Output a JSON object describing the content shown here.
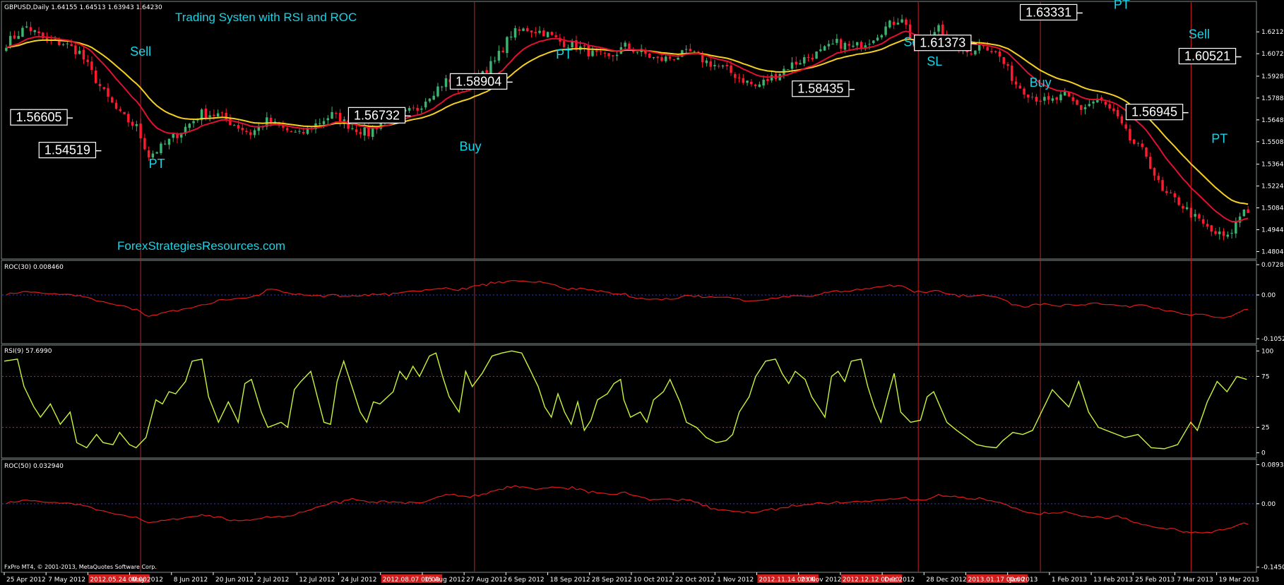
{
  "header": {
    "symbol_info": "GBPUSD,Daily  1.64155 1.64513 1.63943 1.64230",
    "title": "Trading Systen with RSI and ROC",
    "watermark": "ForexStrategiesResources.com",
    "copyright": "FxPro MT4, © 2001-2013, MetaQuotes Software Corp."
  },
  "colors": {
    "background": "#000000",
    "frame": "#7f8c8d",
    "bull_candle": "#3cb371",
    "bear_candle": "#ff1a2e",
    "ma_fast": "#e01030",
    "ma_slow": "#f5d020",
    "roc_line": "#e01a1a",
    "rsi_line": "#c8f53c",
    "zero_line": "#2a3bd6",
    "rsi_levels": "#c8283c",
    "vline": "#c81e1e",
    "signal_text": "#19d3e6"
  },
  "chart_data": [
    {
      "type": "candlestick",
      "name": "GBPUSD Daily",
      "ylim": [
        1.477,
        1.638
      ],
      "y_ticks": [
        "1.62120",
        "1.60720",
        "1.59280",
        "1.57880",
        "1.56480",
        "1.55080",
        "1.53640",
        "1.52240",
        "1.50840",
        "1.49440",
        "1.48040"
      ],
      "x_ticks": [
        "25 Apr 2012",
        "7 May 2012",
        "2012.05.24 00:00",
        "May 2012",
        "8 Jun 2012",
        "20 Jun 2012",
        "2 Jul 2012",
        "12 Jul 2012",
        "24 Jul 2012",
        "2012.08.07 00:00",
        "15 Aug 2012",
        "27 Aug 2012",
        "6 Sep 2012",
        "18 Sep 2012",
        "28 Sep 2012",
        "10 Oct 2012",
        "22 Oct 2012",
        "1 Nov 2012",
        "2012.11.14 00:00",
        "23 Nov 2012",
        "2012.12.12 00:00",
        "Dec 2012",
        "28 Dec 2012",
        "2013.01.17 00:00",
        "Jan 2013",
        "1 Feb 2013",
        "13 Feb 2013",
        "25 Feb 2013",
        "7 Mar 2013",
        "19 Mar 2013"
      ],
      "close_anchors": [
        [
          0,
          1.614
        ],
        [
          5,
          1.6245
        ],
        [
          10,
          1.615
        ],
        [
          14,
          1.614
        ],
        [
          18,
          1.608
        ],
        [
          24,
          1.582
        ],
        [
          28,
          1.568
        ],
        [
          32,
          1.56
        ],
        [
          35,
          1.542
        ],
        [
          38,
          1.547
        ],
        [
          44,
          1.56
        ],
        [
          48,
          1.569
        ],
        [
          52,
          1.568
        ],
        [
          56,
          1.562
        ],
        [
          60,
          1.556
        ],
        [
          64,
          1.564
        ],
        [
          68,
          1.559
        ],
        [
          72,
          1.555
        ],
        [
          76,
          1.562
        ],
        [
          80,
          1.568
        ],
        [
          85,
          1.56
        ],
        [
          89,
          1.556
        ],
        [
          93,
          1.566
        ],
        [
          97,
          1.568
        ],
        [
          101,
          1.572
        ],
        [
          104,
          1.581
        ],
        [
          108,
          1.59
        ],
        [
          112,
          1.586
        ],
        [
          116,
          1.594
        ],
        [
          120,
          1.602
        ],
        [
          124,
          1.62
        ],
        [
          128,
          1.623
        ],
        [
          132,
          1.621
        ],
        [
          136,
          1.615
        ],
        [
          140,
          1.612
        ],
        [
          144,
          1.607
        ],
        [
          148,
          1.604
        ],
        [
          152,
          1.612
        ],
        [
          156,
          1.608
        ],
        [
          160,
          1.603
        ],
        [
          164,
          1.605
        ],
        [
          168,
          1.608
        ],
        [
          172,
          1.602
        ],
        [
          176,
          1.598
        ],
        [
          180,
          1.592
        ],
        [
          184,
          1.586
        ],
        [
          188,
          1.592
        ],
        [
          192,
          1.599
        ],
        [
          196,
          1.604
        ],
        [
          200,
          1.608
        ],
        [
          204,
          1.614
        ],
        [
          208,
          1.611
        ],
        [
          212,
          1.616
        ],
        [
          216,
          1.624
        ],
        [
          220,
          1.631
        ],
        [
          223,
          1.612
        ],
        [
          226,
          1.613
        ],
        [
          229,
          1.626
        ],
        [
          232,
          1.614
        ],
        [
          236,
          1.608
        ],
        [
          240,
          1.614
        ],
        [
          244,
          1.605
        ],
        [
          248,
          1.588
        ],
        [
          252,
          1.58
        ],
        [
          256,
          1.576
        ],
        [
          260,
          1.58
        ],
        [
          264,
          1.572
        ],
        [
          268,
          1.578
        ],
        [
          272,
          1.569
        ],
        [
          276,
          1.552
        ],
        [
          280,
          1.542
        ],
        [
          284,
          1.518
        ],
        [
          288,
          1.512
        ],
        [
          292,
          1.502
        ],
        [
          296,
          1.493
        ],
        [
          300,
          1.489
        ],
        [
          304,
          1.508
        ],
        [
          306,
          1.506
        ]
      ],
      "ma_fast_ma": 13,
      "ma_slow_ma": 25,
      "annotations": [
        {
          "text": "Sell",
          "i": 33,
          "price": 1.606,
          "kind": "signal"
        },
        {
          "text": "1.56605",
          "i": 16,
          "price": 1.566,
          "kind": "price"
        },
        {
          "text": "1.54519",
          "i": 23,
          "price": 1.545,
          "kind": "price"
        },
        {
          "text": "PT",
          "i": 37,
          "price": 1.534,
          "kind": "signal"
        },
        {
          "text": "1.56732",
          "i": 99,
          "price": 1.5673,
          "kind": "price"
        },
        {
          "text": "Buy",
          "i": 114,
          "price": 1.545,
          "kind": "signal"
        },
        {
          "text": "1.58904",
          "i": 124,
          "price": 1.589,
          "kind": "price"
        },
        {
          "text": "PT",
          "i": 137,
          "price": 1.604,
          "kind": "signal"
        },
        {
          "text": "1.58435",
          "i": 208,
          "price": 1.5843,
          "kind": "price"
        },
        {
          "text": "Sell",
          "i": 223,
          "price": 1.612,
          "kind": "signal"
        },
        {
          "text": "SL",
          "i": 228,
          "price": 1.5995,
          "kind": "signal"
        },
        {
          "text": "1.61373",
          "i": 238,
          "price": 1.6137,
          "kind": "price"
        },
        {
          "text": "Buy",
          "i": 254,
          "price": 1.586,
          "kind": "signal"
        },
        {
          "text": "1.63331",
          "i": 264,
          "price": 1.6333,
          "kind": "price"
        },
        {
          "text": "PT",
          "i": 274,
          "price": 1.636,
          "kind": "signal"
        },
        {
          "text": "Sell",
          "i": 293,
          "price": 1.617,
          "kind": "signal"
        },
        {
          "text": "1.60521",
          "i": 303,
          "price": 1.6052,
          "kind": "price"
        },
        {
          "text": "1.56945",
          "i": 290,
          "price": 1.5694,
          "kind": "price"
        },
        {
          "text": "PT",
          "i": 298,
          "price": 1.55,
          "kind": "signal"
        }
      ],
      "vlines_i": [
        33,
        115,
        224,
        254,
        291
      ]
    },
    {
      "type": "line",
      "name": "ROC(30)",
      "label": "ROC(30) 0.008460",
      "y_ticks": [
        "0.072805",
        "0.00",
        "-0.105296"
      ],
      "ylim": [
        -0.112,
        0.078
      ]
    },
    {
      "type": "line",
      "name": "RSI",
      "label": "RSI(9) 57.6990",
      "y_ticks": [
        "100",
        "75",
        "25",
        "0"
      ],
      "ylim": [
        -3,
        103
      ],
      "levels": [
        75,
        25
      ],
      "anchors": [
        [
          0,
          90
        ],
        [
          4,
          92
        ],
        [
          6,
          65
        ],
        [
          9,
          45
        ],
        [
          11,
          35
        ],
        [
          14,
          48
        ],
        [
          17,
          28
        ],
        [
          20,
          40
        ],
        [
          22,
          10
        ],
        [
          25,
          5
        ],
        [
          28,
          18
        ],
        [
          30,
          10
        ],
        [
          33,
          8
        ],
        [
          35,
          20
        ],
        [
          38,
          8
        ],
        [
          40,
          5
        ],
        [
          43,
          15
        ],
        [
          46,
          52
        ],
        [
          48,
          48
        ],
        [
          50,
          60
        ],
        [
          52,
          58
        ],
        [
          55,
          70
        ],
        [
          57,
          90
        ],
        [
          60,
          92
        ],
        [
          62,
          55
        ],
        [
          65,
          30
        ],
        [
          68,
          50
        ],
        [
          71,
          30
        ],
        [
          73,
          68
        ],
        [
          75,
          72
        ],
        [
          78,
          40
        ],
        [
          80,
          25
        ],
        [
          84,
          30
        ],
        [
          86,
          25
        ],
        [
          88,
          62
        ],
        [
          90,
          70
        ],
        [
          93,
          80
        ],
        [
          95,
          55
        ],
        [
          97,
          30
        ],
        [
          99,
          28
        ],
        [
          101,
          70
        ],
        [
          103,
          90
        ],
        [
          106,
          60
        ],
        [
          108,
          40
        ],
        [
          110,
          30
        ],
        [
          112,
          50
        ],
        [
          114,
          48
        ],
        [
          118,
          60
        ],
        [
          120,
          80
        ],
        [
          122,
          72
        ],
        [
          124,
          85
        ],
        [
          126,
          75
        ],
        [
          129,
          95
        ],
        [
          131,
          98
        ],
        [
          133,
          75
        ],
        [
          135,
          55
        ],
        [
          138,
          40
        ],
        [
          140,
          80
        ],
        [
          142,
          65
        ],
        [
          145,
          78
        ],
        [
          148,
          95
        ],
        [
          151,
          98
        ],
        [
          154,
          100
        ],
        [
          157,
          98
        ],
        [
          159,
          85
        ],
        [
          162,
          65
        ],
        [
          164,
          45
        ],
        [
          166,
          35
        ],
        [
          168,
          58
        ],
        [
          170,
          40
        ],
        [
          172,
          28
        ],
        [
          174,
          50
        ],
        [
          176,
          22
        ],
        [
          178,
          32
        ],
        [
          180,
          52
        ],
        [
          183,
          58
        ],
        [
          185,
          68
        ],
        [
          187,
          72
        ],
        [
          188,
          52
        ],
        [
          190,
          35
        ],
        [
          193,
          40
        ],
        [
          195,
          30
        ],
        [
          197,
          52
        ],
        [
          200,
          60
        ],
        [
          202,
          72
        ],
        [
          205,
          50
        ],
        [
          207,
          30
        ],
        [
          210,
          25
        ],
        [
          213,
          15
        ],
        [
          216,
          10
        ],
        [
          219,
          12
        ],
        [
          221,
          18
        ],
        [
          223,
          40
        ],
        [
          226,
          55
        ],
        [
          228,
          75
        ],
        [
          231,
          90
        ],
        [
          234,
          92
        ],
        [
          236,
          78
        ],
        [
          238,
          68
        ],
        [
          240,
          80
        ],
        [
          243,
          72
        ],
        [
          245,
          55
        ],
        [
          247,
          45
        ],
        [
          249,
          35
        ],
        [
          251,
          75
        ],
        [
          253,
          80
        ],
        [
          255,
          70
        ],
        [
          257,
          90
        ],
        [
          260,
          92
        ],
        [
          262,
          65
        ],
        [
          264,
          45
        ],
        [
          266,
          30
        ],
        [
          268,
          55
        ],
        [
          270,
          78
        ],
        [
          272,
          40
        ],
        [
          275,
          30
        ],
        [
          278,
          32
        ],
        [
          280,
          55
        ],
        [
          282,
          60
        ],
        [
          284,
          45
        ],
        [
          286,
          30
        ],
        [
          289,
          22
        ],
        [
          292,
          15
        ],
        [
          295,
          8
        ],
        [
          298,
          6
        ],
        [
          301,
          5
        ],
        [
          303,
          12
        ],
        [
          306,
          20
        ],
        [
          309,
          18
        ],
        [
          312,
          22
        ],
        [
          315,
          42
        ],
        [
          318,
          62
        ],
        [
          320,
          55
        ],
        [
          323,
          45
        ],
        [
          326,
          70
        ],
        [
          329,
          40
        ],
        [
          332,
          25
        ],
        [
          336,
          20
        ],
        [
          340,
          15
        ],
        [
          344,
          18
        ],
        [
          348,
          5
        ],
        [
          352,
          4
        ],
        [
          356,
          8
        ],
        [
          360,
          30
        ],
        [
          362,
          22
        ],
        [
          365,
          50
        ],
        [
          368,
          70
        ],
        [
          371,
          60
        ],
        [
          374,
          75
        ],
        [
          377,
          72
        ]
      ]
    },
    {
      "type": "line",
      "name": "ROC(50)",
      "label": "ROC(50) 0.032940",
      "y_ticks": [
        "0.089384",
        "0.00",
        "-0.145004"
      ],
      "ylim": [
        -0.152,
        0.095
      ]
    }
  ]
}
